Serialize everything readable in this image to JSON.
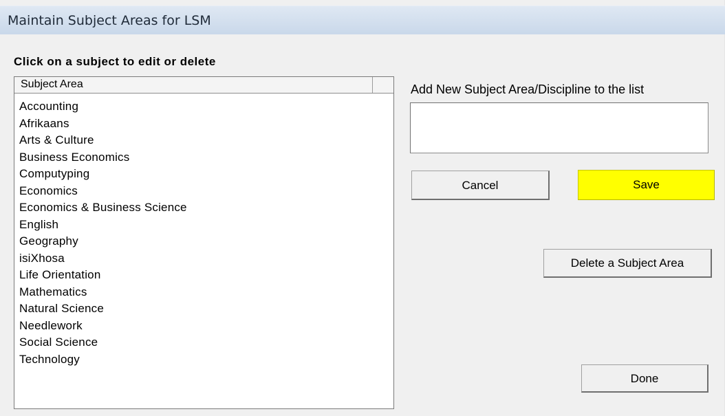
{
  "window": {
    "title": "Maintain Subject Areas for LSM"
  },
  "instruction": "Click on a subject to edit or delete",
  "subject_list": {
    "column_header": "Subject Area",
    "items": [
      "Accounting",
      "Afrikaans",
      "Arts & Culture",
      "Business Economics",
      "Computyping",
      "Economics",
      "Economics & Business Science",
      "English",
      "Geography",
      "isiXhosa",
      "Life Orientation",
      "Mathematics",
      "Natural Science",
      "Needlework",
      "Social Science",
      "Technology"
    ]
  },
  "add_form": {
    "label": "Add New Subject Area/Discipline to the list",
    "value": "",
    "cancel_label": "Cancel",
    "save_label": "Save"
  },
  "actions": {
    "delete_label": "Delete a Subject Area",
    "done_label": "Done"
  },
  "colors": {
    "save_button": "#ffff00",
    "titlebar": "#c9d8ea",
    "window_background": "#f0f0f0"
  }
}
